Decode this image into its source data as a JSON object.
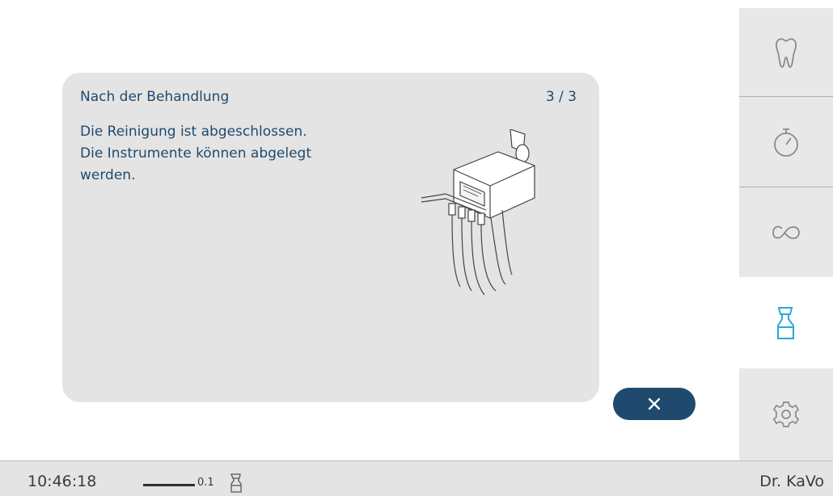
{
  "dialog": {
    "title": "Nach der Behandlung",
    "page": "3 / 3",
    "message_lines": [
      "Die Reinigung ist abgeschlossen.",
      "Die Instrumente können abgelegt",
      "werden."
    ],
    "close_icon": "close-icon"
  },
  "sidebar": {
    "items": [
      {
        "icon": "tooth-icon",
        "active": false
      },
      {
        "icon": "stopwatch-icon",
        "active": false
      },
      {
        "icon": "infinity-loop-icon",
        "active": false
      },
      {
        "icon": "spray-bottle-icon",
        "active": true
      },
      {
        "icon": "gear-icon",
        "active": false
      }
    ]
  },
  "status": {
    "time": "10:46:18",
    "usage_value": "0.1",
    "usage_icon": "spray-bottle-icon",
    "user": "Dr. KaVo"
  },
  "colors": {
    "primary": "#1f4a6e",
    "active_icon": "#2aa9d8",
    "panel_bg": "#e4e4e4",
    "inactive_icon": "#8a8a8a"
  }
}
